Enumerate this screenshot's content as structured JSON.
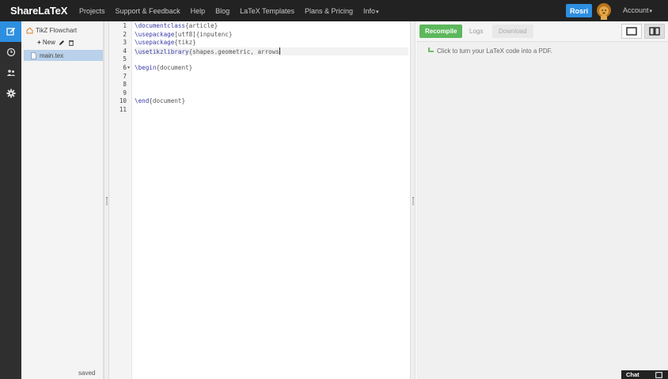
{
  "app": {
    "brand": "ShareLaTeX"
  },
  "nav": {
    "items": [
      "Projects",
      "Support & Feedback",
      "Help",
      "Blog",
      "LaTeX Templates",
      "Plans & Pricing"
    ],
    "info_label": "Info",
    "user_button": "Rosri",
    "account_label": "Account"
  },
  "rail": {
    "icons": [
      "edit-icon",
      "history-icon",
      "share-icon",
      "settings-icon"
    ]
  },
  "filetree": {
    "project_name": "TikZ Flowchart",
    "new_label": "New",
    "files": [
      "main.tex"
    ],
    "status": "saved"
  },
  "editor": {
    "line_numbers": [
      "1",
      "2",
      "3",
      "4",
      "5",
      "6",
      "7",
      "8",
      "9",
      "10",
      "11"
    ],
    "fold_markers": {
      "6": "▾"
    },
    "active_line": 4,
    "lines": [
      [
        {
          "t": "\\documentclass",
          "c": "kw"
        },
        {
          "t": "{article}",
          "c": "br"
        }
      ],
      [
        {
          "t": "\\usepackage",
          "c": "kw"
        },
        {
          "t": "[utf8]{inputenc}",
          "c": "br"
        }
      ],
      [
        {
          "t": "\\usepackage",
          "c": "kw"
        },
        {
          "t": "{tikz}",
          "c": "br"
        }
      ],
      [
        {
          "t": "\\usetikzlibrary",
          "c": "kw"
        },
        {
          "t": "{shapes.geometric, arrows",
          "c": "br"
        }
      ],
      [],
      [
        {
          "t": "\\begin",
          "c": "kw"
        },
        {
          "t": "{document}",
          "c": "br"
        }
      ],
      [],
      [],
      [],
      [
        {
          "t": "\\end",
          "c": "kw"
        },
        {
          "t": "{document}",
          "c": "br"
        }
      ],
      []
    ]
  },
  "pdf": {
    "recompile_label": "Recompile",
    "logs_label": "Logs",
    "download_label": "Download",
    "hint": "Click to turn your LaTeX code into a PDF."
  },
  "chat": {
    "label": "Chat"
  },
  "colors": {
    "accent_blue": "#2d8fe0",
    "recompile_green": "#5cb85c",
    "topbar": "#222222"
  }
}
